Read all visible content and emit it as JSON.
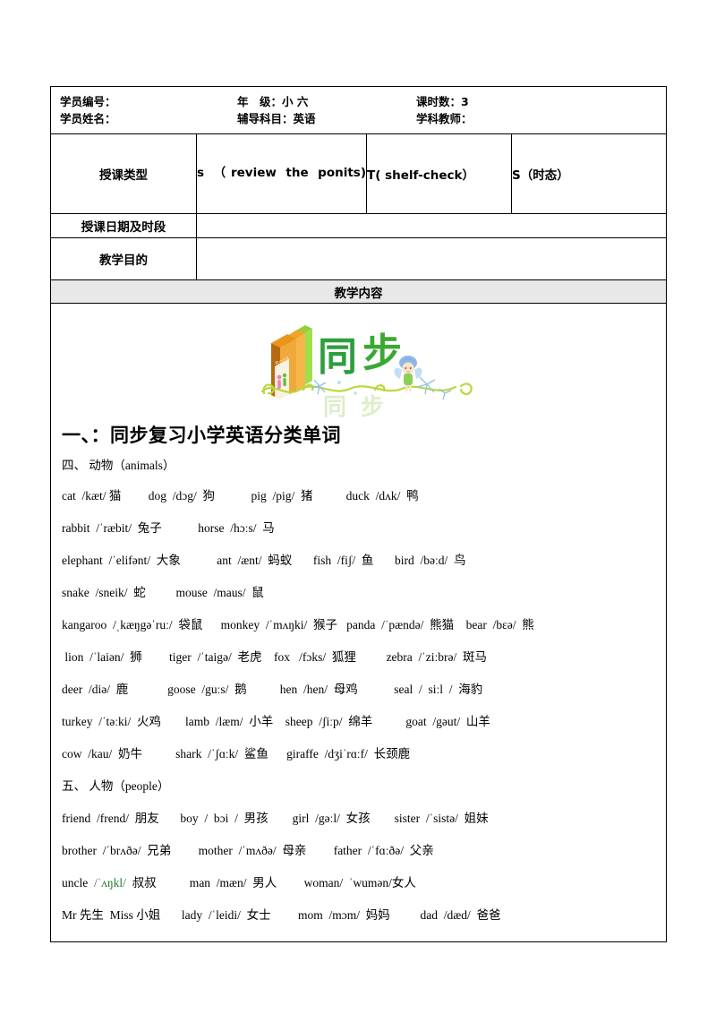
{
  "table": {
    "info": {
      "rows": [
        {
          "a_label": "学员编号：",
          "a_value": "",
          "b_label": "年　级：",
          "b_value": "小 六",
          "c_label": "课时数：",
          "c_value": "3"
        },
        {
          "a_label": "学员姓名：",
          "a_value": "",
          "b_label": "辅导科目：",
          "b_value": "英语",
          "c_label": "学科教师：",
          "c_value": ""
        }
      ]
    },
    "lesson_type": {
      "label": "授课类型",
      "cell_a": "s （review the ponits)",
      "cell_b": "T( shelf-check）",
      "cell_c": "S（时态）"
    },
    "date_row": {
      "label": "授课日期及时段",
      "value": ""
    },
    "goal_row": {
      "label": "教学目的",
      "value": ""
    },
    "content_banner": "教学内容"
  },
  "content": {
    "decor_alt": "同步辅导 book-fairy-banner",
    "decor_text_main": "同 步",
    "decor_text_shadow": "同 步",
    "decor_book_label": "Book",
    "main_heading": "一、：同步复习小学英语分类单词",
    "section_animals": "四、 动物（animals）",
    "section_people": "五、 人物（people）",
    "animal_lines": [
      "cat  /kæt/ 猫         dog  /dɔg/  狗            pig  /pig/  猪           duck  /dʌk/  鸭",
      "rabbit  /ˈræbit/  兔子            horse  /hɔːs/  马",
      "elephant  /ˈelifənt/  大象            ant  /ænt/  蚂蚁       fish  /fiʃ/  鱼       bird  /bəːd/  鸟",
      "snake  /sneik/  蛇          mouse  /maus/  鼠",
      "kangaroo  /ˌkæŋgəˈruː/  袋鼠      monkey  /ˈmʌŋki/  猴子   panda  /ˈpændə/  熊猫    bear  /bɛə/  熊",
      " lion  /ˈlaiən/  狮         tiger  /ˈtaigə/  老虎    fox   /fɔks/  狐狸          zebra  /ˈziːbrə/  斑马",
      "deer  /diə/  鹿             goose  /guːs/  鹅           hen  /hen/  母鸡            seal  /  siːl  /  海豹",
      "turkey  /ˈtəːki/  火鸡        lamb  /læm/  小羊    sheep  /ʃiːp/  绵羊           goat  /gəut/  山羊",
      "cow  /kau/  奶牛           shark  /ˈʃɑːk/  鲨鱼      giraffe  /dʒiˈrɑːf/  长颈鹿"
    ],
    "people_lines": [
      "friend  /frend/  朋友       boy  /  bɔi  /  男孩        girl  /gəːl/  女孩        sister  /ˈsistə/  姐妹",
      "brother  /ˈbrʌðə/  兄弟         mother  /ˈmʌðə/  母亲         father  /ˈfɑːðə/  父亲",
      "uncle  /ˈʌŋkl/  叔叔           man  /mæn/  男人         woman/  ˈwumən/女人",
      "Mr 先生  Miss 小姐       lady  /ˈleidi/  女士         mom  /mɔm/  妈妈          dad  /dæd/  爸爸"
    ],
    "uncle_green_part": "/ˈʌŋkl/"
  },
  "colors": {
    "banner_bg": "#e8e8e8",
    "border": "#000000",
    "green_accent": "#1f7a33",
    "decor_green": "#2e9e3e",
    "decor_orange": "#e8951a",
    "decor_lightgreen": "#a8d82a",
    "decor_blue": "#7fb6e8"
  }
}
